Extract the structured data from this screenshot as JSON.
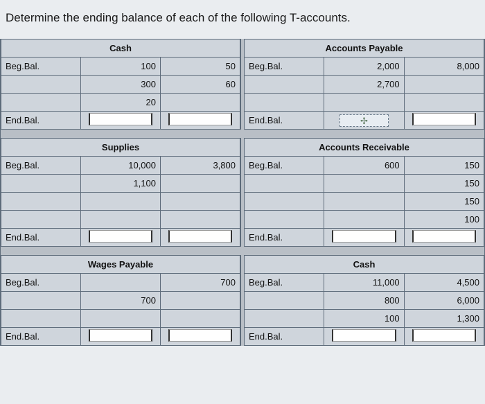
{
  "question": "Determine the ending balance of each of the following T-accounts.",
  "labels": {
    "beg": "Beg.Bal.",
    "end": "End.Bal."
  },
  "plusSymbol": "✢",
  "accounts": [
    {
      "left": {
        "title": "Cash",
        "rows": [
          {
            "label": "Beg.Bal.",
            "debit": "100",
            "credit": "50"
          },
          {
            "label": "",
            "debit": "300",
            "credit": "60"
          },
          {
            "label": "",
            "debit": "20",
            "credit": ""
          }
        ],
        "end": {
          "label": "End.Bal.",
          "debitBox": true,
          "creditBox": true,
          "plus": false
        }
      },
      "right": {
        "title": "Accounts Payable",
        "rows": [
          {
            "label": "Beg.Bal.",
            "debit": "2,000",
            "credit": "8,000"
          },
          {
            "label": "",
            "debit": "2,700",
            "credit": ""
          },
          {
            "label": "",
            "debit": "",
            "credit": ""
          }
        ],
        "end": {
          "label": "End.Bal.",
          "debitBox": false,
          "creditBox": true,
          "plus": true
        }
      }
    },
    {
      "left": {
        "title": "Supplies",
        "rows": [
          {
            "label": "Beg.Bal.",
            "debit": "10,000",
            "credit": "3,800"
          },
          {
            "label": "",
            "debit": "1,100",
            "credit": ""
          },
          {
            "label": "",
            "debit": "",
            "credit": ""
          },
          {
            "label": "",
            "debit": "",
            "credit": ""
          }
        ],
        "end": {
          "label": "End.Bal.",
          "debitBox": true,
          "creditBox": true,
          "plus": false
        }
      },
      "right": {
        "title": "Accounts Receivable",
        "rows": [
          {
            "label": "Beg.Bal.",
            "debit": "600",
            "credit": "150"
          },
          {
            "label": "",
            "debit": "",
            "credit": "150"
          },
          {
            "label": "",
            "debit": "",
            "credit": "150"
          },
          {
            "label": "",
            "debit": "",
            "credit": "100"
          }
        ],
        "end": {
          "label": "End.Bal.",
          "debitBox": true,
          "creditBox": true,
          "plus": false
        }
      }
    },
    {
      "left": {
        "title": "Wages Payable",
        "rows": [
          {
            "label": "Beg.Bal.",
            "debit": "",
            "credit": "700"
          },
          {
            "label": "",
            "debit": "700",
            "credit": ""
          },
          {
            "label": "",
            "debit": "",
            "credit": ""
          }
        ],
        "end": {
          "label": "End.Bal.",
          "debitBox": true,
          "creditBox": true,
          "plus": false
        }
      },
      "right": {
        "title": "Cash",
        "rows": [
          {
            "label": "Beg.Bal.",
            "debit": "11,000",
            "credit": "4,500"
          },
          {
            "label": "",
            "debit": "800",
            "credit": "6,000"
          },
          {
            "label": "",
            "debit": "100",
            "credit": "1,300"
          }
        ],
        "end": {
          "label": "End.Bal.",
          "debitBox": true,
          "creditBox": true,
          "plus": false
        }
      }
    }
  ]
}
